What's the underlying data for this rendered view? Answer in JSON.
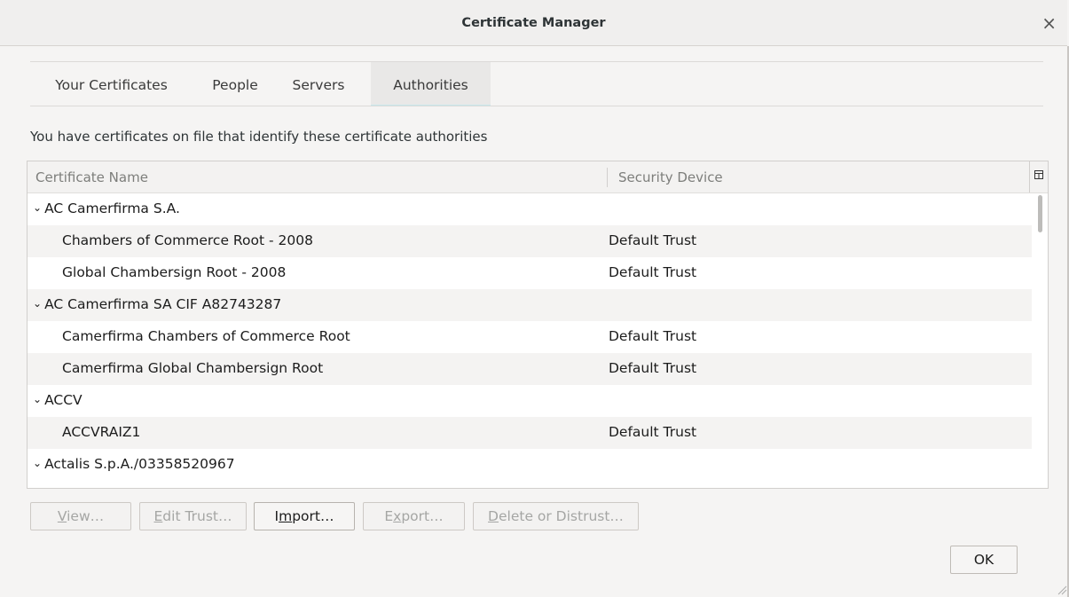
{
  "window": {
    "title": "Certificate Manager",
    "close_glyph": "×"
  },
  "tabs": [
    {
      "label": "Your Certificates",
      "selected": false
    },
    {
      "label": "People",
      "selected": false
    },
    {
      "label": "Servers",
      "selected": false
    },
    {
      "label": "Authorities",
      "selected": true
    }
  ],
  "description": "You have certificates on file that identify these certificate authorities",
  "table": {
    "columns": [
      "Certificate Name",
      "Security Device"
    ],
    "column_picker_icon": "column-picker-icon",
    "rows": [
      {
        "type": "group",
        "name": "AC Camerfirma S.A.",
        "device": ""
      },
      {
        "type": "child",
        "name": "Chambers of Commerce Root - 2008",
        "device": "Default Trust"
      },
      {
        "type": "child",
        "name": "Global Chambersign Root - 2008",
        "device": "Default Trust"
      },
      {
        "type": "group",
        "name": "AC Camerfirma SA CIF A82743287",
        "device": ""
      },
      {
        "type": "child",
        "name": "Camerfirma Chambers of Commerce Root",
        "device": "Default Trust"
      },
      {
        "type": "child",
        "name": "Camerfirma Global Chambersign Root",
        "device": "Default Trust"
      },
      {
        "type": "group",
        "name": "ACCV",
        "device": ""
      },
      {
        "type": "child",
        "name": "ACCVRAIZ1",
        "device": "Default Trust"
      },
      {
        "type": "group",
        "name": "Actalis S.p.A./03358520967",
        "device": ""
      }
    ]
  },
  "buttons": {
    "view": {
      "before": "",
      "accel": "V",
      "after": "iew…",
      "enabled": false
    },
    "edit_trust": {
      "before": "",
      "accel": "E",
      "after": "dit Trust…",
      "enabled": false
    },
    "import": {
      "before": "I",
      "accel": "m",
      "after": "port…",
      "enabled": true
    },
    "export": {
      "before": "E",
      "accel": "x",
      "after": "port…",
      "enabled": false
    },
    "delete": {
      "before": "",
      "accel": "D",
      "after": "elete or Distrust…",
      "enabled": false
    }
  },
  "ok_label": "OK",
  "colors": {
    "selected_tab_underline": "#c7e8ec",
    "disabled_text": "#a5a6a4"
  }
}
